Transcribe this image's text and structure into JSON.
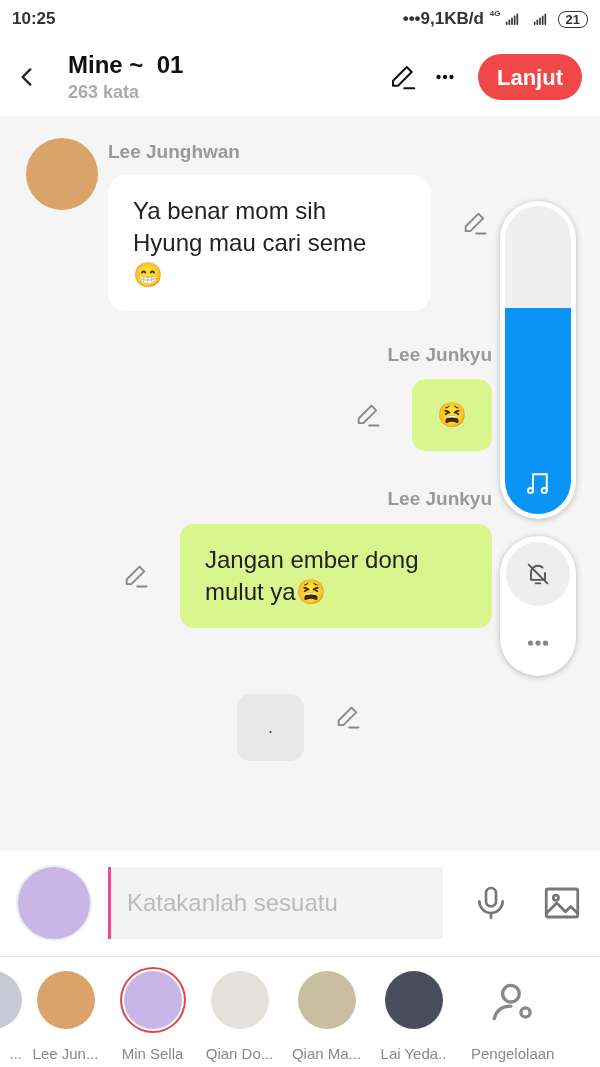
{
  "status_bar": {
    "time": "10:25",
    "network": "•••9,1KB/d",
    "network_type": "4G",
    "battery": "21"
  },
  "header": {
    "title": "Mine ~  01",
    "subtitle": "263 kata",
    "action": "Lanjut"
  },
  "messages": [
    {
      "kind": "left",
      "sender": "Lee Junghwan",
      "text": "Ya benar mom sih Hyung mau cari seme 😁"
    },
    {
      "kind": "right",
      "sender": "Lee Junkyu",
      "text": "😫"
    },
    {
      "kind": "right",
      "sender": "Lee Junkyu",
      "text": "Jangan ember dong mulut ya😫"
    },
    {
      "kind": "center",
      "text": "."
    }
  ],
  "volume": {
    "level": 0.67
  },
  "composer": {
    "placeholder": "Katakanlah sesuatu"
  },
  "characters": [
    {
      "name": "...",
      "selected": false,
      "color": "#c8cad8",
      "partial": true
    },
    {
      "name": "Lee Jun...",
      "selected": false,
      "color": "#d9a36a"
    },
    {
      "name": "Min Sella",
      "selected": true,
      "color": "#c9b6e6"
    },
    {
      "name": "Qian Do...",
      "selected": false,
      "color": "#e4e1dc"
    },
    {
      "name": "Qian Ma...",
      "selected": false,
      "color": "#c9bfa0"
    },
    {
      "name": "Lai Yeda..",
      "selected": false,
      "color": "#4a4d5c"
    }
  ],
  "manage_label": "Pengelolaan"
}
